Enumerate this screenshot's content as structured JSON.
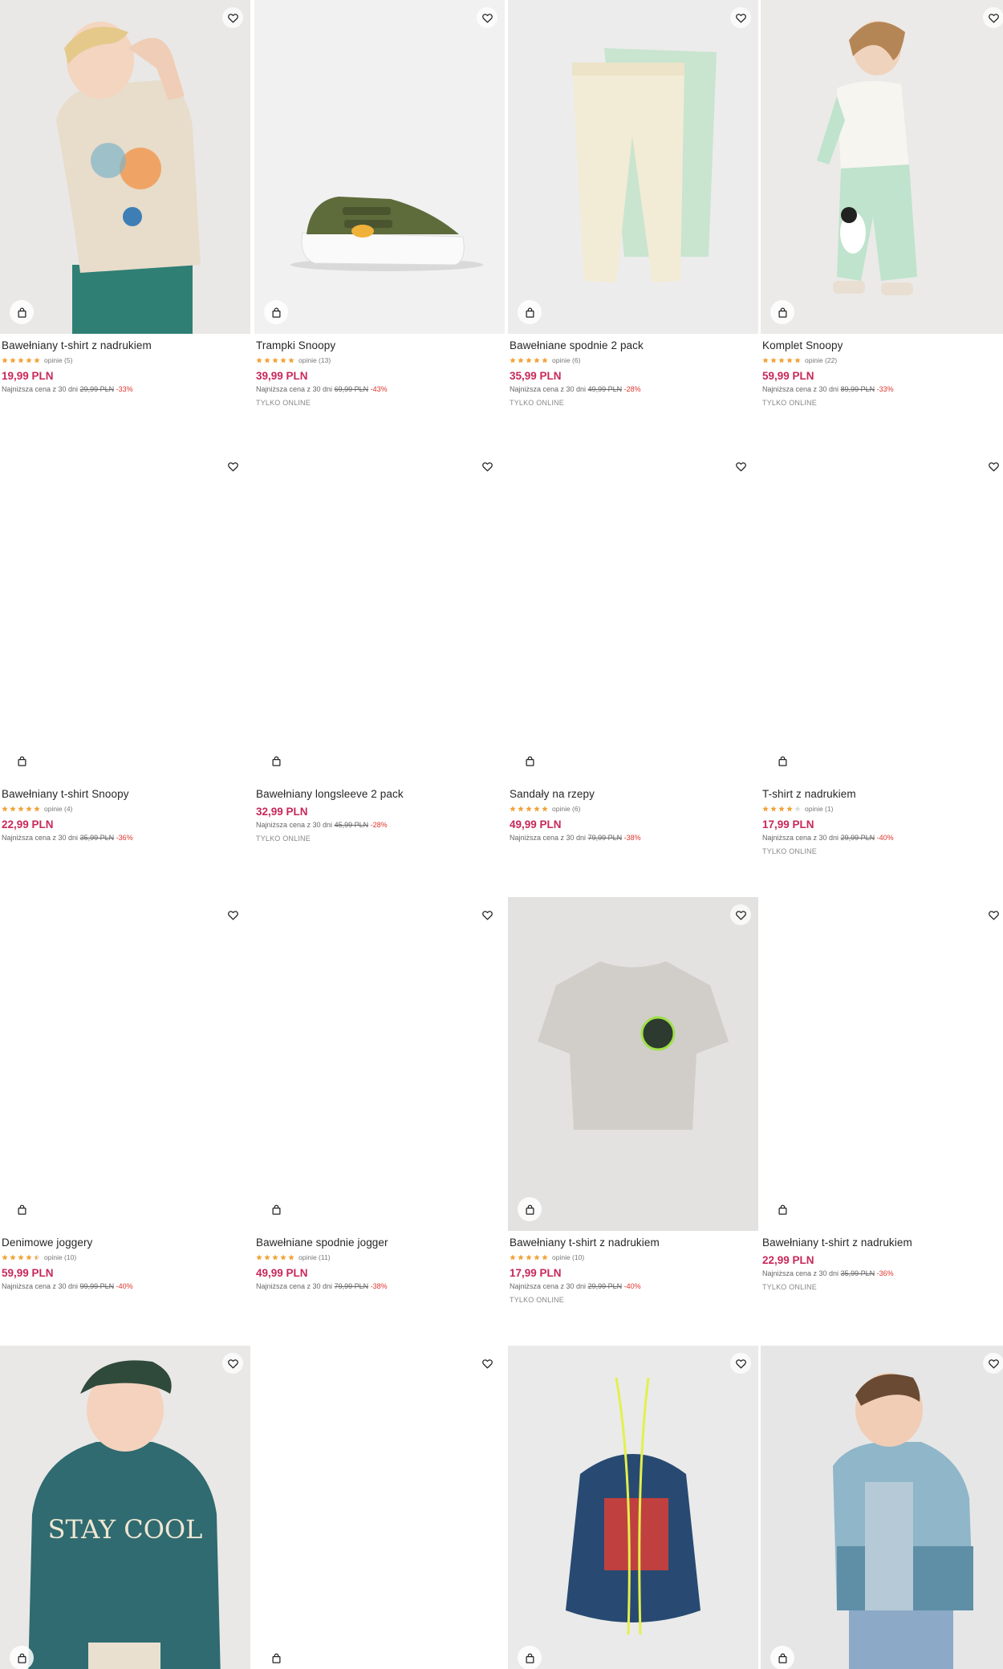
{
  "colors": {
    "price": "#c8285a",
    "discount": "#e0352b",
    "star": "#f2a33a",
    "star_empty": "#dddddd"
  },
  "icons": {
    "favorite": "heart-icon",
    "add_to_cart": "shopping-bag-icon"
  },
  "products": [
    {
      "name": "Bawełniany t-shirt z nadrukiem",
      "rating": 5,
      "reviews": "opinie (5)",
      "price": "19,99 PLN",
      "lowest_label": "Najniższa cena z 30 dni",
      "old_price": "29,99 PLN",
      "discount": "-33%",
      "online_only": "",
      "image": "boy-printed-tshirt"
    },
    {
      "name": "Trampki Snoopy",
      "rating": 5,
      "reviews": "opinie (13)",
      "price": "39,99 PLN",
      "lowest_label": "Najniższa cena z 30 dni",
      "old_price": "69,99 PLN",
      "discount": "-43%",
      "online_only": "TYLKO ONLINE",
      "image": "green-sneaker"
    },
    {
      "name": "Bawełniane spodnie 2 pack",
      "rating": 5,
      "reviews": "opinie (6)",
      "price": "35,99 PLN",
      "lowest_label": "Najniższa cena z 30 dni",
      "old_price": "49,99 PLN",
      "discount": "-28%",
      "online_only": "TYLKO ONLINE",
      "image": "pants-2-pack"
    },
    {
      "name": "Komplet Snoopy",
      "rating": 5,
      "reviews": "opinie (22)",
      "price": "59,99 PLN",
      "lowest_label": "Najniższa cena z 30 dni",
      "old_price": "89,99 PLN",
      "discount": "-33%",
      "online_only": "TYLKO ONLINE",
      "image": "kid-snoopy-set"
    },
    {
      "name": "Bawełniany t-shirt Snoopy",
      "rating": 5,
      "reviews": "opinie (4)",
      "price": "22,99 PLN",
      "lowest_label": "Najniższa cena z 30 dni",
      "old_price": "35,99 PLN",
      "discount": "-36%",
      "online_only": "",
      "image": ""
    },
    {
      "name": "Bawełniany longsleeve 2 pack",
      "rating": 0,
      "reviews": "",
      "price": "32,99 PLN",
      "lowest_label": "Najniższa cena z 30 dni",
      "old_price": "45,99 PLN",
      "discount": "-28%",
      "online_only": "TYLKO ONLINE",
      "image": ""
    },
    {
      "name": "Sandały na rzepy",
      "rating": 5,
      "reviews": "opinie (6)",
      "price": "49,99 PLN",
      "lowest_label": "Najniższa cena z 30 dni",
      "old_price": "79,99 PLN",
      "discount": "-38%",
      "online_only": "",
      "image": ""
    },
    {
      "name": "T-shirt z nadrukiem",
      "rating": 4,
      "reviews": "opinie (1)",
      "price": "17,99 PLN",
      "lowest_label": "Najniższa cena z 30 dni",
      "old_price": "29,99 PLN",
      "discount": "-40%",
      "online_only": "TYLKO ONLINE",
      "image": ""
    },
    {
      "name": "Denimowe joggery",
      "rating": 4.5,
      "reviews": "opinie (10)",
      "price": "59,99 PLN",
      "lowest_label": "Najniższa cena z 30 dni",
      "old_price": "99,99 PLN",
      "discount": "-40%",
      "online_only": "",
      "image": ""
    },
    {
      "name": "Bawełniane spodnie jogger",
      "rating": 5,
      "reviews": "opinie (11)",
      "price": "49,99 PLN",
      "lowest_label": "Najniższa cena z 30 dni",
      "old_price": "79,99 PLN",
      "discount": "-38%",
      "online_only": "",
      "image": ""
    },
    {
      "name": "Bawełniany t-shirt z nadrukiem",
      "rating": 5,
      "reviews": "opinie (10)",
      "price": "17,99 PLN",
      "lowest_label": "Najniższa cena z 30 dni",
      "old_price": "29,99 PLN",
      "discount": "-40%",
      "online_only": "TYLKO ONLINE",
      "image": "gray-tshirt"
    },
    {
      "name": "Bawełniany t-shirt z nadrukiem",
      "rating": 0,
      "reviews": "",
      "price": "22,99 PLN",
      "lowest_label": "Najniższa cena z 30 dni",
      "old_price": "35,99 PLN",
      "discount": "-36%",
      "online_only": "TYLKO ONLINE",
      "image": ""
    },
    {
      "name": "",
      "image": "boy-stay-cool-sweatshirt",
      "photo_text": "STAY COOL"
    },
    {
      "name": "",
      "image": ""
    },
    {
      "name": "",
      "image": "drawstring-bag"
    },
    {
      "name": "",
      "image": "boy-blue-hoodie"
    }
  ]
}
